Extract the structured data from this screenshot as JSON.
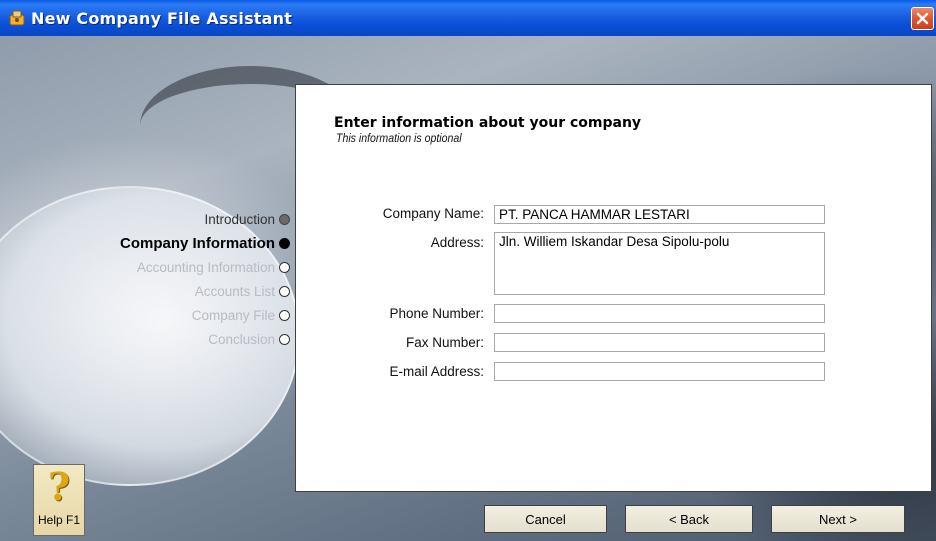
{
  "window": {
    "title": "New Company File Assistant"
  },
  "steps": [
    {
      "label": "Introduction",
      "state": "done"
    },
    {
      "label": "Company Information",
      "state": "current"
    },
    {
      "label": "Accounting Information",
      "state": "pending"
    },
    {
      "label": "Accounts List",
      "state": "pending"
    },
    {
      "label": "Company File",
      "state": "pending"
    },
    {
      "label": "Conclusion",
      "state": "pending"
    }
  ],
  "form": {
    "heading": "Enter information about your company",
    "subheading": "This information is optional",
    "fields": {
      "company_name": {
        "label": "Company Name:",
        "value": "PT. PANCA HAMMAR LESTARI"
      },
      "address": {
        "label": "Address:",
        "value": "Jln. Williem Iskandar Desa Sipolu-polu"
      },
      "phone": {
        "label": "Phone Number:",
        "value": ""
      },
      "fax": {
        "label": "Fax Number:",
        "value": ""
      },
      "email": {
        "label": "E-mail Address:",
        "value": ""
      }
    }
  },
  "buttons": {
    "help": "Help F1",
    "help_icon": "question-mark-icon",
    "cancel": "Cancel",
    "back": "< Back",
    "next": "Next >"
  },
  "colors": {
    "titlebar": "#0a4fd6",
    "close": "#e0552f"
  }
}
